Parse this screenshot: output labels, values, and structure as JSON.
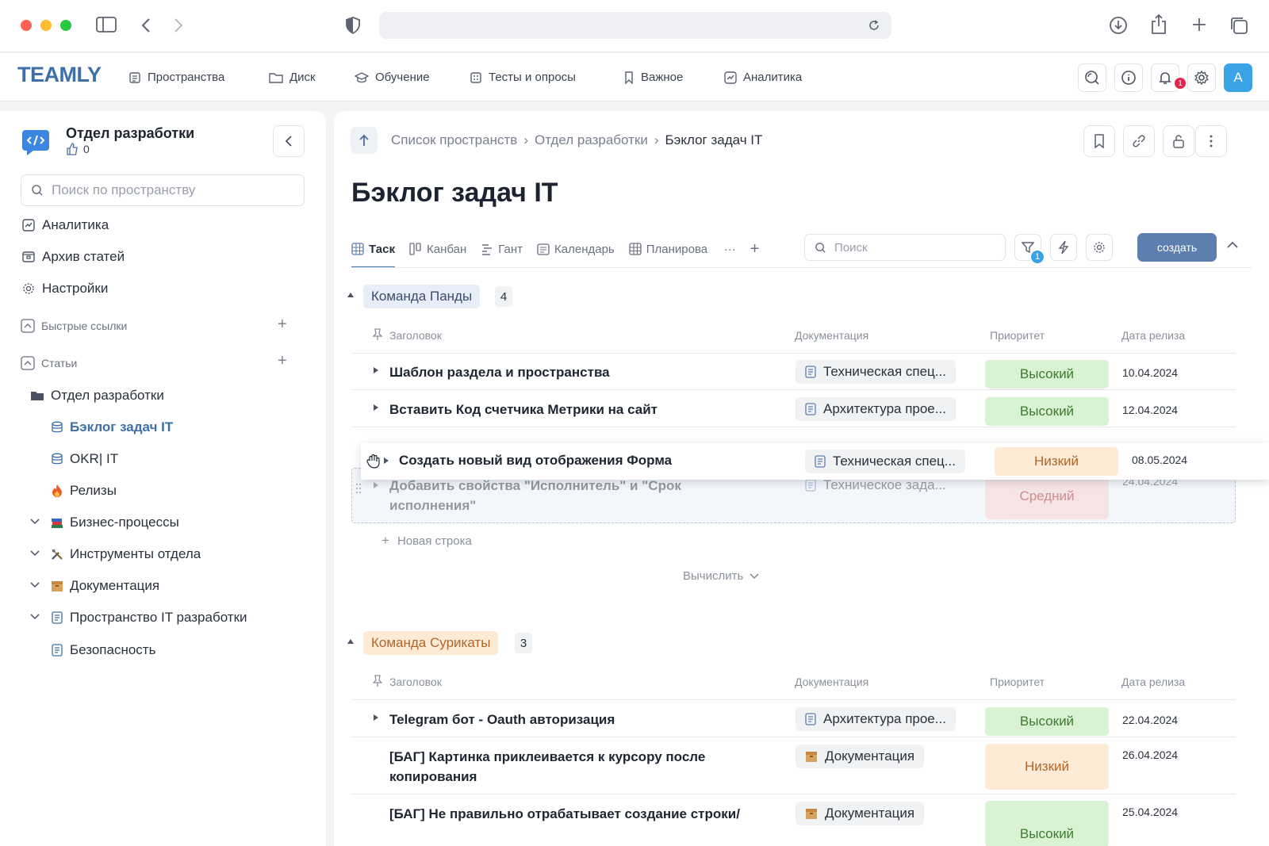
{
  "header": {
    "logo": "TEAMLY",
    "nav": [
      {
        "label": "Пространства",
        "icon": "spaces-icon"
      },
      {
        "label": "Диск",
        "icon": "folder-icon"
      },
      {
        "label": "Обучение",
        "icon": "graduation-cap-icon"
      },
      {
        "label": "Тесты и опросы",
        "icon": "test-icon"
      },
      {
        "label": "Важное",
        "icon": "bookmark-icon"
      },
      {
        "label": "Аналитика",
        "icon": "analytics-icon"
      }
    ],
    "notifications_count": "1",
    "avatar_letter": "A"
  },
  "sidebar": {
    "space_title": "Отдел разработки",
    "likes": "0",
    "search_placeholder": "Поиск по пространству",
    "menu": [
      {
        "label": "Аналитика",
        "icon": "analytics-icon"
      },
      {
        "label": "Архив статей",
        "icon": "archive-icon"
      },
      {
        "label": "Настройки",
        "icon": "gear-icon"
      }
    ],
    "sections": {
      "quick_links": "Быстрые ссылки",
      "articles": "Статьи"
    },
    "tree": [
      {
        "label": "Отдел разработки",
        "icon": "folder-icon"
      },
      {
        "label": "Бэклог задач IT",
        "icon": "database-icon"
      },
      {
        "label": "OKR| IT",
        "icon": "database-icon"
      },
      {
        "label": "Релизы",
        "icon": "fire-icon"
      },
      {
        "label": "Бизнес-процессы",
        "icon": "books-icon"
      },
      {
        "label": "Инструменты отдела",
        "icon": "tools-icon"
      },
      {
        "label": "Документация",
        "icon": "box-icon"
      },
      {
        "label": "Пространство IT разработки",
        "icon": "document-icon"
      },
      {
        "label": "Безопасность",
        "icon": "document-icon"
      }
    ]
  },
  "main": {
    "breadcrumb": [
      "Список пространств",
      "Отдел разработки",
      "Бэклог задач IT"
    ],
    "breadcrumb_sep": "›",
    "title": "Бэклог задач IT",
    "tabs": [
      {
        "label": "Таск",
        "icon": "table-icon"
      },
      {
        "label": "Канбан",
        "icon": "kanban-icon"
      },
      {
        "label": "Гант",
        "icon": "gantt-icon"
      },
      {
        "label": "Календарь",
        "icon": "calendar-icon"
      },
      {
        "label": "Планирова",
        "icon": "table-icon"
      }
    ],
    "tabs_more": "···",
    "search_placeholder": "Поиск",
    "filter_count": "1",
    "create_label": "создать",
    "columns": {
      "title": "Заголовок",
      "docs": "Документация",
      "priority": "Приоритет",
      "date": "Дата релиза"
    },
    "groups": [
      {
        "name": "Команда Панды",
        "count": "4",
        "color": "#e7eef8",
        "rows": [
          {
            "title": "Шаблон раздела и пространства",
            "doc": "Техническая спец...",
            "priority": "Высокий",
            "date": "10.04.2024"
          },
          {
            "title": "Вставить Код счетчика Метрики на сайт",
            "doc": "Архитектура прое...",
            "priority": "Высокий",
            "date": "12.04.2024"
          },
          {
            "title": "Добавить свойства \"Исполнитель\" и \"Срок исполнения\"",
            "doc": "Техническое зада...",
            "priority": "Средний",
            "date": "24.04.2024"
          }
        ],
        "dragging": {
          "title": "Создать новый вид отображения Форма",
          "doc": "Техническая спец...",
          "priority": "Низкий",
          "date": "08.05.2024"
        },
        "new_row": "Новая строка",
        "calc": "Вычислить"
      },
      {
        "name": "Команда Сурикаты",
        "count": "3",
        "color": "#fdebd6",
        "rows": [
          {
            "title": "Telegram бот - Oauth авторизация",
            "doc": "Архитектура прое...",
            "priority": "Высокий",
            "date": "22.04.2024"
          },
          {
            "title": "[БАГ] Картинка приклеивается к курсору после копирования",
            "doc": "Документация",
            "priority": "Низкий",
            "date": "26.04.2024"
          },
          {
            "title": "[БАГ] Не правильно отрабатывает создание строки/",
            "doc": "Документация",
            "priority": "Высокий",
            "date": "25.04.2024"
          }
        ]
      }
    ]
  }
}
